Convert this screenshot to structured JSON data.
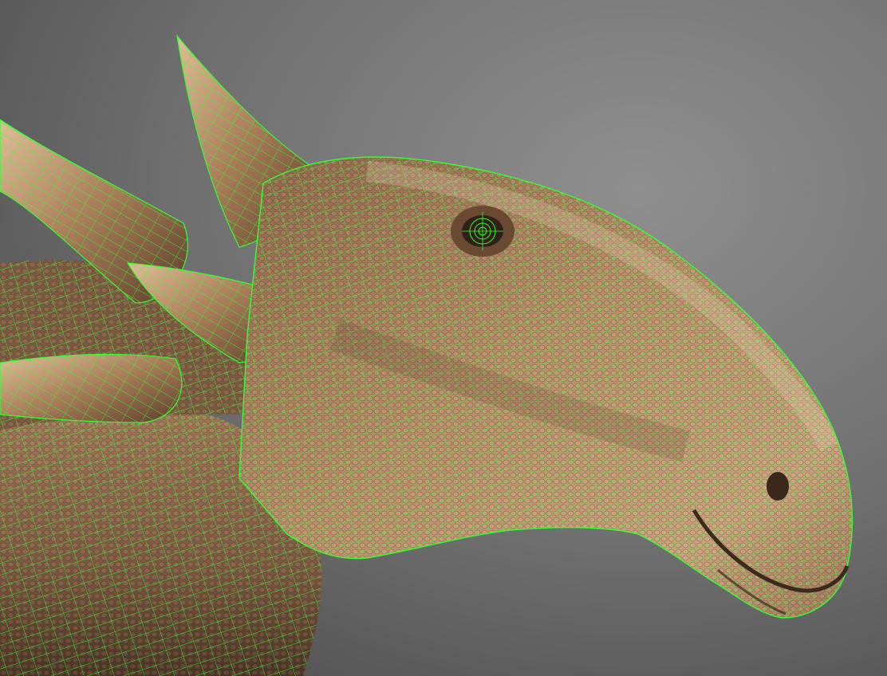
{
  "scene": {
    "subject": "dinosaur-head-wireframe-render",
    "colors": {
      "background_light": "#8a8a8a",
      "background_dark": "#4e4e4e",
      "skin_light": "#c9a47e",
      "skin_mid": "#9b7352",
      "skin_dark": "#4f3826",
      "horn_light": "#d8b48f",
      "horn_dark": "#6b4a33",
      "wire": "#33ff33"
    }
  }
}
